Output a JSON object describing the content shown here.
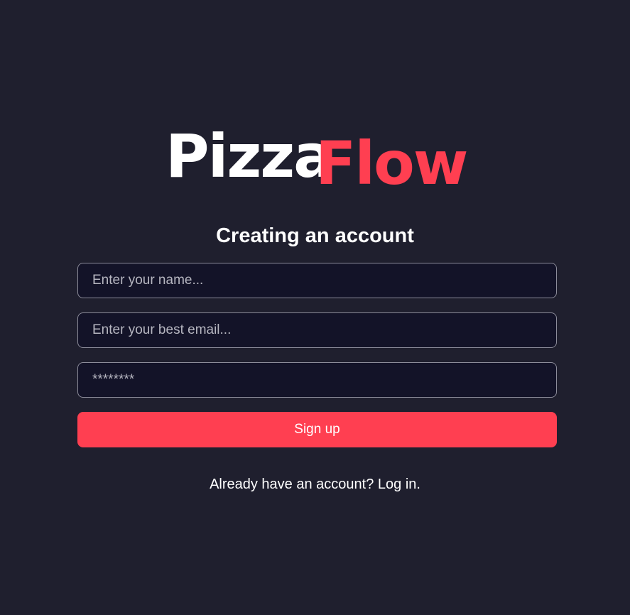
{
  "logo": {
    "part_a": "Pizza",
    "part_b": "Flow",
    "colors": {
      "part_a": "#ffffff",
      "part_b": "#ff3f51"
    }
  },
  "form": {
    "title": "Creating an account",
    "name_placeholder": "Enter your name...",
    "email_placeholder": "Enter your best email...",
    "password_placeholder": "********",
    "signup_label": "Sign up",
    "login_link": "Already have an account? Log in."
  },
  "colors": {
    "background": "#1f1f2e",
    "input_background": "#131328",
    "input_border": "#8c8c9a",
    "accent": "#ff3f51",
    "text": "#ffffff"
  }
}
